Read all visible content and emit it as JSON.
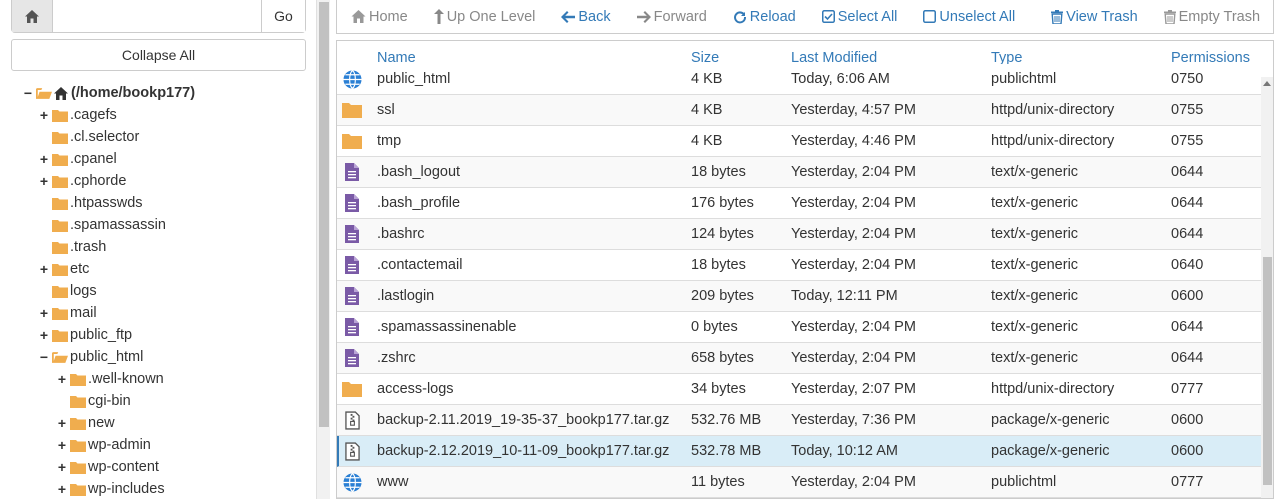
{
  "search": {
    "placeholder": "",
    "go_label": "Go"
  },
  "collapse_label": "Collapse All",
  "tree": [
    {
      "label": "(/home/bookp177)",
      "toggle": "−",
      "level": 0,
      "root": true,
      "open": true
    },
    {
      "label": ".cagefs",
      "toggle": "+",
      "level": 1
    },
    {
      "label": ".cl.selector",
      "toggle": "",
      "level": 1
    },
    {
      "label": ".cpanel",
      "toggle": "+",
      "level": 1
    },
    {
      "label": ".cphorde",
      "toggle": "+",
      "level": 1
    },
    {
      "label": ".htpasswds",
      "toggle": "",
      "level": 1
    },
    {
      "label": ".spamassassin",
      "toggle": "",
      "level": 1
    },
    {
      "label": ".trash",
      "toggle": "",
      "level": 1
    },
    {
      "label": "etc",
      "toggle": "+",
      "level": 1
    },
    {
      "label": "logs",
      "toggle": "",
      "level": 1
    },
    {
      "label": "mail",
      "toggle": "+",
      "level": 1
    },
    {
      "label": "public_ftp",
      "toggle": "+",
      "level": 1
    },
    {
      "label": "public_html",
      "toggle": "−",
      "level": 1,
      "open": true
    },
    {
      "label": ".well-known",
      "toggle": "+",
      "level": 2
    },
    {
      "label": "cgi-bin",
      "toggle": "",
      "level": 2
    },
    {
      "label": "new",
      "toggle": "+",
      "level": 2
    },
    {
      "label": "wp-admin",
      "toggle": "+",
      "level": 2
    },
    {
      "label": "wp-content",
      "toggle": "+",
      "level": 2
    },
    {
      "label": "wp-includes",
      "toggle": "+",
      "level": 2
    }
  ],
  "toolbar": {
    "home": "Home",
    "up": "Up One Level",
    "back": "Back",
    "forward": "Forward",
    "reload": "Reload",
    "select_all": "Select All",
    "unselect_all": "Unselect All",
    "view_trash": "View Trash",
    "empty_trash": "Empty Trash"
  },
  "columns": {
    "name": "Name",
    "size": "Size",
    "modified": "Last Modified",
    "type": "Type",
    "perms": "Permissions"
  },
  "files": [
    {
      "icon": "globe-icon",
      "name": "public_html",
      "size": "4 KB",
      "modified": "Today, 6:06 AM",
      "type": "publichtml",
      "perms": "0750"
    },
    {
      "icon": "folder-icon",
      "name": "ssl",
      "size": "4 KB",
      "modified": "Yesterday, 4:57 PM",
      "type": "httpd/unix-directory",
      "perms": "0755"
    },
    {
      "icon": "folder-icon",
      "name": "tmp",
      "size": "4 KB",
      "modified": "Yesterday, 4:46 PM",
      "type": "httpd/unix-directory",
      "perms": "0755"
    },
    {
      "icon": "file-text-icon",
      "name": ".bash_logout",
      "size": "18 bytes",
      "modified": "Yesterday, 2:04 PM",
      "type": "text/x-generic",
      "perms": "0644"
    },
    {
      "icon": "file-text-icon",
      "name": ".bash_profile",
      "size": "176 bytes",
      "modified": "Yesterday, 2:04 PM",
      "type": "text/x-generic",
      "perms": "0644"
    },
    {
      "icon": "file-text-icon",
      "name": ".bashrc",
      "size": "124 bytes",
      "modified": "Yesterday, 2:04 PM",
      "type": "text/x-generic",
      "perms": "0644"
    },
    {
      "icon": "file-text-icon",
      "name": ".contactemail",
      "size": "18 bytes",
      "modified": "Yesterday, 2:04 PM",
      "type": "text/x-generic",
      "perms": "0640"
    },
    {
      "icon": "file-text-icon",
      "name": ".lastlogin",
      "size": "209 bytes",
      "modified": "Today, 12:11 PM",
      "type": "text/x-generic",
      "perms": "0600"
    },
    {
      "icon": "file-text-icon",
      "name": ".spamassassinenable",
      "size": "0 bytes",
      "modified": "Yesterday, 2:04 PM",
      "type": "text/x-generic",
      "perms": "0644"
    },
    {
      "icon": "file-text-icon",
      "name": ".zshrc",
      "size": "658 bytes",
      "modified": "Yesterday, 2:04 PM",
      "type": "text/x-generic",
      "perms": "0644"
    },
    {
      "icon": "folder-icon",
      "name": "access-logs",
      "size": "34 bytes",
      "modified": "Yesterday, 2:07 PM",
      "type": "httpd/unix-directory",
      "perms": "0777"
    },
    {
      "icon": "archive-icon",
      "name": "backup-2.11.2019_19-35-37_bookp177.tar.gz",
      "size": "532.76 MB",
      "modified": "Yesterday, 7:36 PM",
      "type": "package/x-generic",
      "perms": "0600"
    },
    {
      "icon": "archive-icon",
      "name": "backup-2.12.2019_10-11-09_bookp177.tar.gz",
      "size": "532.78 MB",
      "modified": "Today, 10:12 AM",
      "type": "package/x-generic",
      "perms": "0600",
      "selected": true
    },
    {
      "icon": "globe-icon",
      "name": "www",
      "size": "11 bytes",
      "modified": "Yesterday, 2:04 PM",
      "type": "publichtml",
      "perms": "0777"
    }
  ],
  "colors": {
    "link": "#337ab7",
    "folder": "#f0ad4e",
    "file_text": "#7a5aa6",
    "globe": "#2a7fd4",
    "selected_row": "#d9edf7"
  }
}
